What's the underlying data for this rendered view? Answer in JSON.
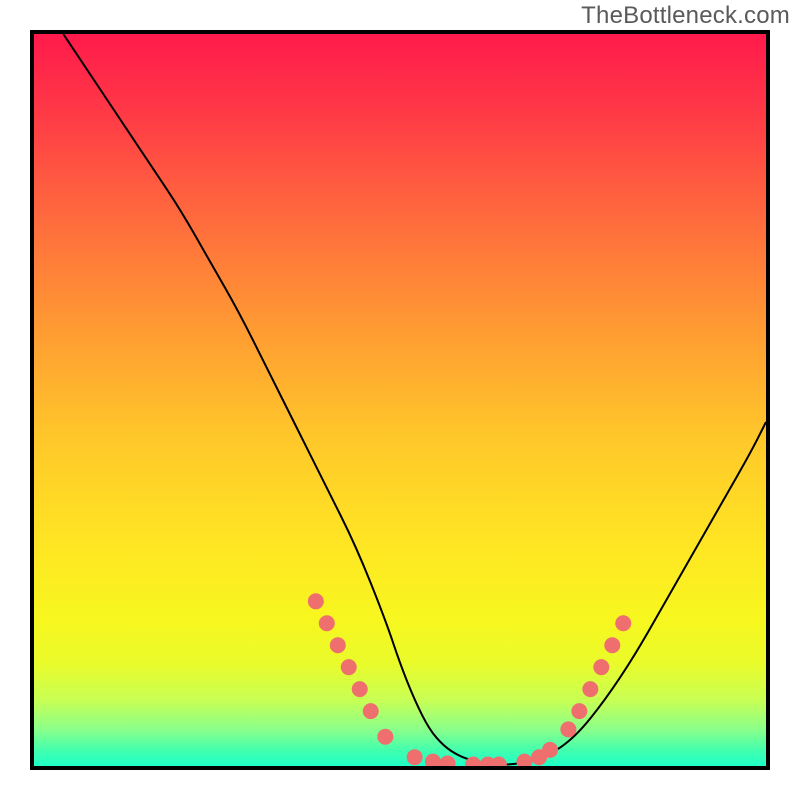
{
  "watermark": "TheBottleneck.com",
  "gradient": {
    "stops": [
      {
        "offset": "0%",
        "color": "#ff1a4b"
      },
      {
        "offset": "10%",
        "color": "#ff3747"
      },
      {
        "offset": "25%",
        "color": "#ff6a3d"
      },
      {
        "offset": "40%",
        "color": "#ff9a33"
      },
      {
        "offset": "55%",
        "color": "#ffc72a"
      },
      {
        "offset": "70%",
        "color": "#ffe623"
      },
      {
        "offset": "80%",
        "color": "#f7f71f"
      },
      {
        "offset": "86%",
        "color": "#e9fb2a"
      },
      {
        "offset": "91%",
        "color": "#c8ff54"
      },
      {
        "offset": "95%",
        "color": "#8aff8a"
      },
      {
        "offset": "98%",
        "color": "#3fffb0"
      },
      {
        "offset": "100%",
        "color": "#1fffc8"
      }
    ]
  },
  "curve_color": "#000000",
  "curve_width": 2,
  "marker": {
    "color": "#ef6e6e",
    "radius": 8
  },
  "chart_data": {
    "type": "line",
    "title": "",
    "xlabel": "",
    "ylabel": "",
    "xlim": [
      0,
      100
    ],
    "ylim": [
      0,
      100
    ],
    "grid": false,
    "series": [
      {
        "name": "curve",
        "x": [
          4,
          8,
          12,
          16,
          20,
          24,
          28,
          32,
          36,
          40,
          44,
          48,
          50,
          52,
          54,
          56,
          58,
          60,
          62,
          66,
          70,
          74,
          78,
          82,
          86,
          90,
          94,
          98,
          100
        ],
        "y": [
          100,
          94,
          88,
          82,
          76,
          69,
          62,
          54,
          46,
          38,
          30,
          20,
          14,
          9,
          5,
          2.7,
          1.4,
          0.7,
          0.2,
          0.2,
          1.2,
          4,
          9,
          15,
          22,
          29,
          36,
          43,
          47
        ]
      }
    ],
    "markers": [
      {
        "x": 38.5,
        "y": 22.5
      },
      {
        "x": 40.0,
        "y": 19.5
      },
      {
        "x": 41.5,
        "y": 16.5
      },
      {
        "x": 43.0,
        "y": 13.5
      },
      {
        "x": 44.5,
        "y": 10.5
      },
      {
        "x": 46.0,
        "y": 7.5
      },
      {
        "x": 48.0,
        "y": 4.0
      },
      {
        "x": 52.0,
        "y": 1.2
      },
      {
        "x": 54.5,
        "y": 0.6
      },
      {
        "x": 56.5,
        "y": 0.35
      },
      {
        "x": 60.0,
        "y": 0.2
      },
      {
        "x": 62.0,
        "y": 0.2
      },
      {
        "x": 63.5,
        "y": 0.2
      },
      {
        "x": 67.0,
        "y": 0.6
      },
      {
        "x": 69.0,
        "y": 1.2
      },
      {
        "x": 70.5,
        "y": 2.2
      },
      {
        "x": 73.0,
        "y": 5.0
      },
      {
        "x": 74.5,
        "y": 7.5
      },
      {
        "x": 76.0,
        "y": 10.5
      },
      {
        "x": 77.5,
        "y": 13.5
      },
      {
        "x": 79.0,
        "y": 16.5
      },
      {
        "x": 80.5,
        "y": 19.5
      }
    ]
  }
}
